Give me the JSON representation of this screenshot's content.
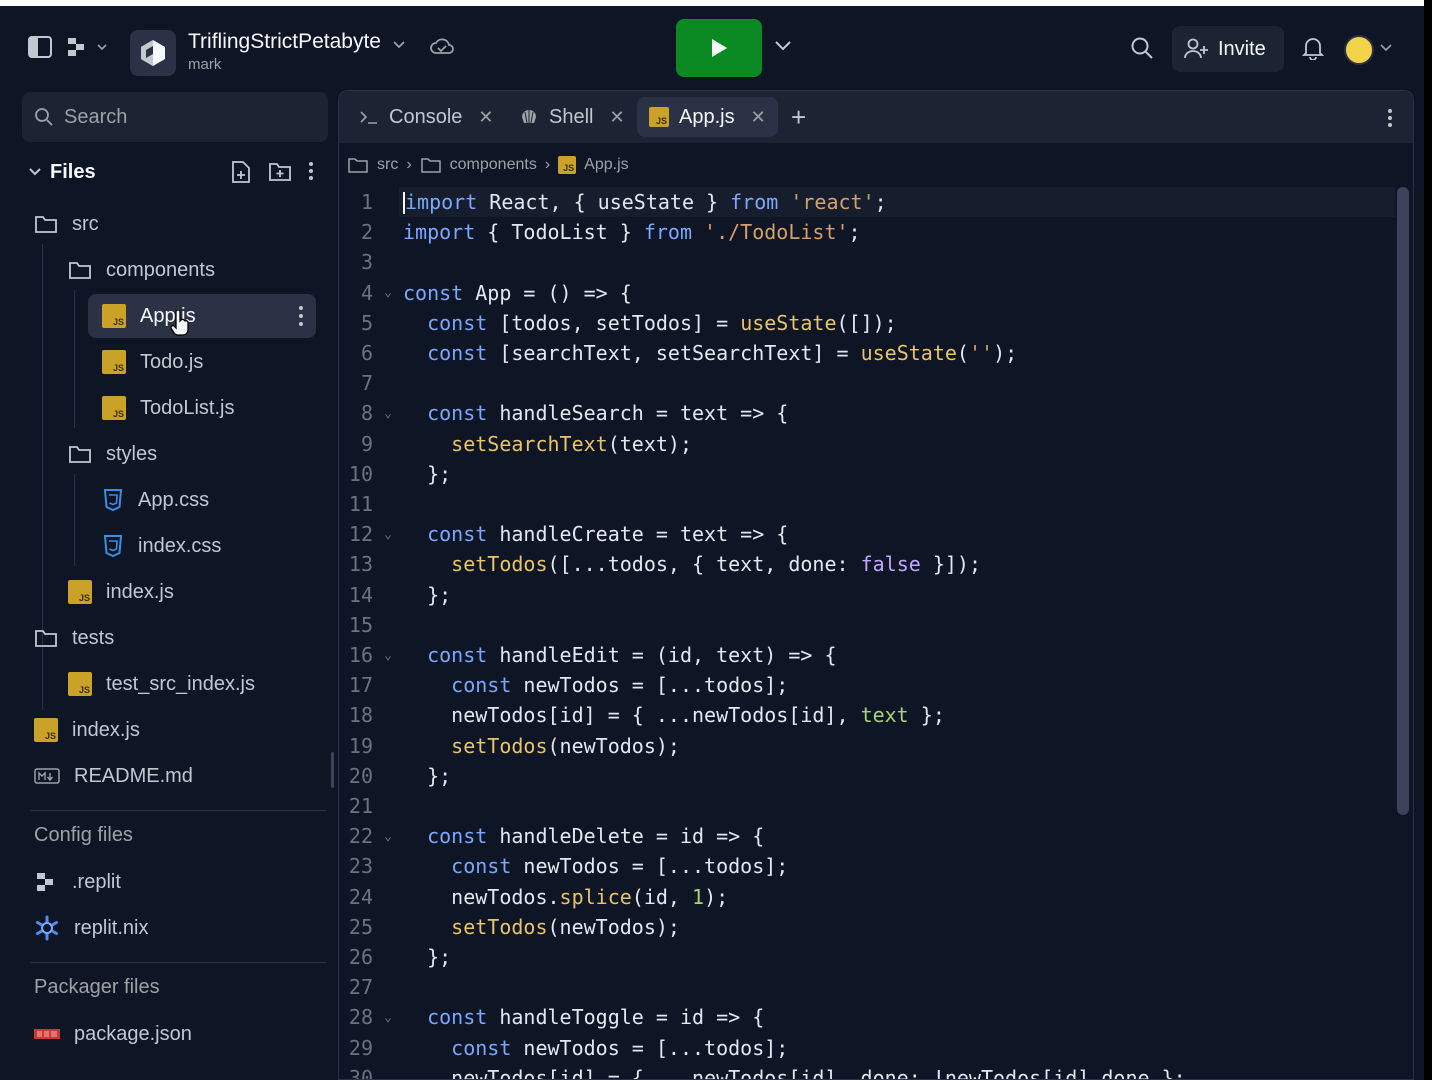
{
  "header": {
    "repl_name": "TriflingStrictPetabyte",
    "repl_owner": "mark",
    "invite_label": "Invite"
  },
  "sidebar": {
    "search_placeholder": "Search",
    "files_title": "Files",
    "tree": [
      {
        "label": "src",
        "icon": "folder-icon"
      },
      {
        "label": "components",
        "icon": "folder-icon"
      },
      {
        "label": "App.js",
        "icon": "js-file-icon"
      },
      {
        "label": "Todo.js",
        "icon": "js-file-icon"
      },
      {
        "label": "TodoList.js",
        "icon": "js-file-icon"
      },
      {
        "label": "styles",
        "icon": "folder-icon"
      },
      {
        "label": "App.css",
        "icon": "css-file-icon"
      },
      {
        "label": "index.css",
        "icon": "css-file-icon"
      },
      {
        "label": "index.js",
        "icon": "js-file-icon"
      },
      {
        "label": "tests",
        "icon": "folder-icon"
      },
      {
        "label": "test_src_index.js",
        "icon": "js-file-icon"
      },
      {
        "label": "index.js",
        "icon": "js-file-icon"
      },
      {
        "label": "README.md",
        "icon": "markdown-file-icon"
      }
    ],
    "config_title": "Config files",
    "config_files": [
      {
        "label": ".replit",
        "icon": "replit-config-icon"
      },
      {
        "label": "replit.nix",
        "icon": "nix-icon"
      }
    ],
    "packager_title": "Packager files",
    "packager_files": [
      {
        "label": "package.json",
        "icon": "npm-icon"
      }
    ]
  },
  "tabs": [
    {
      "label": "Console",
      "icon": "terminal-icon"
    },
    {
      "label": "Shell",
      "icon": "shell-icon"
    },
    {
      "label": "App.js",
      "icon": "js-file-icon",
      "active": true
    }
  ],
  "breadcrumb": [
    "src",
    "components",
    "App.js"
  ],
  "code": [
    [
      [
        "k",
        "import"
      ],
      [
        "t",
        " React, { useState } "
      ],
      [
        "k",
        "from"
      ],
      [
        "t",
        " "
      ],
      [
        "s",
        "'react'"
      ],
      [
        "t",
        ";"
      ]
    ],
    [
      [
        "k",
        "import"
      ],
      [
        "t",
        " { TodoList } "
      ],
      [
        "k",
        "from"
      ],
      [
        "t",
        " "
      ],
      [
        "s",
        "'./TodoList'"
      ],
      [
        "t",
        ";"
      ]
    ],
    [],
    [
      [
        "k",
        "const"
      ],
      [
        "t",
        " App = () => {"
      ]
    ],
    [
      [
        "t",
        "  "
      ],
      [
        "k",
        "const"
      ],
      [
        "t",
        " [todos, setTodos] = "
      ],
      [
        "f",
        "useState"
      ],
      [
        "t",
        "([]);"
      ]
    ],
    [
      [
        "t",
        "  "
      ],
      [
        "k",
        "const"
      ],
      [
        "t",
        " [searchText, setSearchText] = "
      ],
      [
        "f",
        "useState"
      ],
      [
        "t",
        "("
      ],
      [
        "s",
        "''"
      ],
      [
        "t",
        ");"
      ]
    ],
    [],
    [
      [
        "t",
        "  "
      ],
      [
        "k",
        "const"
      ],
      [
        "t",
        " handleSearch = text => {"
      ]
    ],
    [
      [
        "t",
        "    "
      ],
      [
        "f",
        "setSearchText"
      ],
      [
        "t",
        "(text);"
      ]
    ],
    [
      [
        "t",
        "  };"
      ]
    ],
    [],
    [
      [
        "t",
        "  "
      ],
      [
        "k",
        "const"
      ],
      [
        "t",
        " handleCreate = text => {"
      ]
    ],
    [
      [
        "t",
        "    "
      ],
      [
        "f",
        "setTodos"
      ],
      [
        "t",
        "([...todos, { text, done: "
      ],
      [
        "kw2",
        "false"
      ],
      [
        "t",
        " }]);"
      ]
    ],
    [
      [
        "t",
        "  };"
      ]
    ],
    [],
    [
      [
        "t",
        "  "
      ],
      [
        "k",
        "const"
      ],
      [
        "t",
        " handleEdit = (id, text) => {"
      ]
    ],
    [
      [
        "t",
        "    "
      ],
      [
        "k",
        "const"
      ],
      [
        "t",
        " newTodos = [...todos];"
      ]
    ],
    [
      [
        "t",
        "    newTodos[id] = { ...newTodos[id], "
      ],
      [
        "b",
        "text"
      ],
      [
        "t",
        " };"
      ]
    ],
    [
      [
        "t",
        "    "
      ],
      [
        "f",
        "setTodos"
      ],
      [
        "t",
        "(newTodos);"
      ]
    ],
    [
      [
        "t",
        "  };"
      ]
    ],
    [],
    [
      [
        "t",
        "  "
      ],
      [
        "k",
        "const"
      ],
      [
        "t",
        " handleDelete = id => {"
      ]
    ],
    [
      [
        "t",
        "    "
      ],
      [
        "k",
        "const"
      ],
      [
        "t",
        " newTodos = [...todos];"
      ]
    ],
    [
      [
        "t",
        "    newTodos."
      ],
      [
        "f",
        "splice"
      ],
      [
        "t",
        "(id, "
      ],
      [
        "b",
        "1"
      ],
      [
        "t",
        ");"
      ]
    ],
    [
      [
        "t",
        "    "
      ],
      [
        "f",
        "setTodos"
      ],
      [
        "t",
        "(newTodos);"
      ]
    ],
    [
      [
        "t",
        "  };"
      ]
    ],
    [],
    [
      [
        "t",
        "  "
      ],
      [
        "k",
        "const"
      ],
      [
        "t",
        " handleToggle = id => {"
      ]
    ],
    [
      [
        "t",
        "    "
      ],
      [
        "k",
        "const"
      ],
      [
        "t",
        " newTodos = [...todos];"
      ]
    ],
    [
      [
        "t",
        "    newTodos[id] = { ...newTodos[id], done: !newTodos[id].done };"
      ]
    ]
  ]
}
